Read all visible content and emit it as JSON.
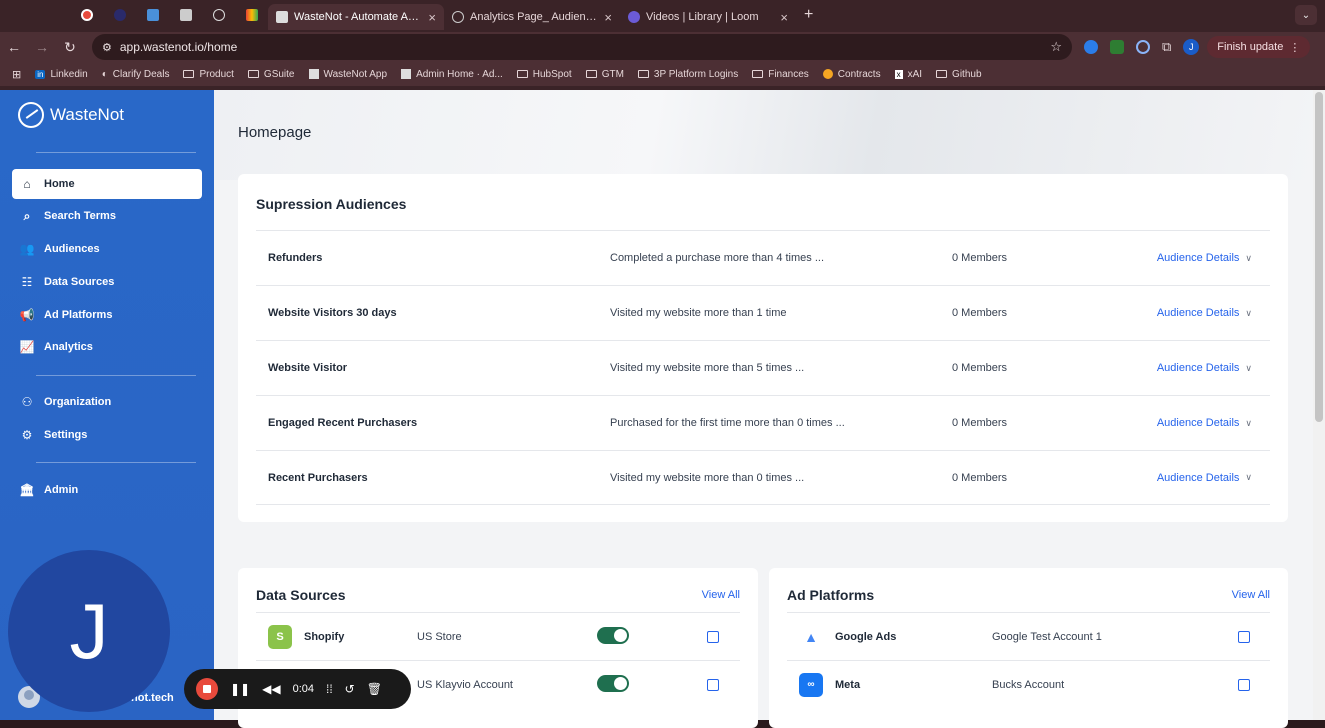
{
  "browser": {
    "pinned_tabs": [
      "red-record-favicon",
      "dark-circle-favicon",
      "blue-note-favicon",
      "admin-favicon",
      "link-favicon",
      "gmail-favicon"
    ],
    "tabs": [
      {
        "title": "WasteNot - Automate Audien",
        "active": true
      },
      {
        "title": "Analytics Page_ Audience Vie",
        "active": false
      },
      {
        "title": "Videos | Library | Loom",
        "active": false
      }
    ],
    "new_tab": "+",
    "url": "app.wastenot.io/home",
    "profile_initial": "J",
    "finish_update": "Finish update",
    "bookmarks": [
      "Linkedin",
      "Clarify Deals",
      "Product",
      "GSuite",
      "WasteNot App",
      "Admin Home · Ad...",
      "HubSpot",
      "GTM",
      "3P Platform Logins",
      "Finances",
      "Contracts",
      "xAI",
      "Github"
    ]
  },
  "sidebar": {
    "brand": "WasteNot",
    "items": [
      {
        "label": "Home",
        "icon": "home-icon",
        "active": true
      },
      {
        "label": "Search Terms",
        "icon": "search-icon"
      },
      {
        "label": "Audiences",
        "icon": "users-icon"
      },
      {
        "label": "Data Sources",
        "icon": "database-icon"
      },
      {
        "label": "Ad Platforms",
        "icon": "megaphone-icon"
      },
      {
        "label": "Analytics",
        "icon": "chart-line-icon"
      },
      {
        "label": "Organization",
        "icon": "organization-icon"
      },
      {
        "label": "Settings",
        "icon": "gear-icon"
      },
      {
        "label": "Admin",
        "icon": "bank-icon"
      }
    ],
    "user_partial": "not.tech"
  },
  "page": {
    "title": "Homepage",
    "suppression": {
      "title": "Supression Audiences",
      "details_label": "Audience Details",
      "rows": [
        {
          "name": "Refunders",
          "desc": "Completed a purchase more than 4 times ...",
          "members": "0 Members"
        },
        {
          "name": "Website Visitors 30 days",
          "desc": "Visited my website more than 1 time",
          "members": "0 Members"
        },
        {
          "name": "Website Visitor",
          "desc": "Visited my website more than 5 times ...",
          "members": "0 Members"
        },
        {
          "name": "Engaged Recent Purchasers",
          "desc": "Purchased for the first time more than 0 times ...",
          "members": "0 Members"
        },
        {
          "name": "Recent Purchasers",
          "desc": "Visited my website more than 0 times ...",
          "members": "0 Members"
        }
      ]
    },
    "data_sources": {
      "title": "Data Sources",
      "view_all": "View All",
      "rows": [
        {
          "name": "Shopify",
          "account": "US Store",
          "enabled": true
        },
        {
          "name": "",
          "account": "US Klayvio Account",
          "enabled": true
        }
      ]
    },
    "ad_platforms": {
      "title": "Ad Platforms",
      "view_all": "View All",
      "rows": [
        {
          "name": "Google Ads",
          "account": "Google Test Account 1"
        },
        {
          "name": "Meta",
          "account": "Bucks Account"
        }
      ]
    }
  },
  "overlay": {
    "avatar_initial": "J",
    "recording_time": "0:04"
  },
  "colors": {
    "sidebar": "#2968c8",
    "link": "#2563eb",
    "toggle_on": "#1f6f4f",
    "record": "#e84a3c"
  }
}
